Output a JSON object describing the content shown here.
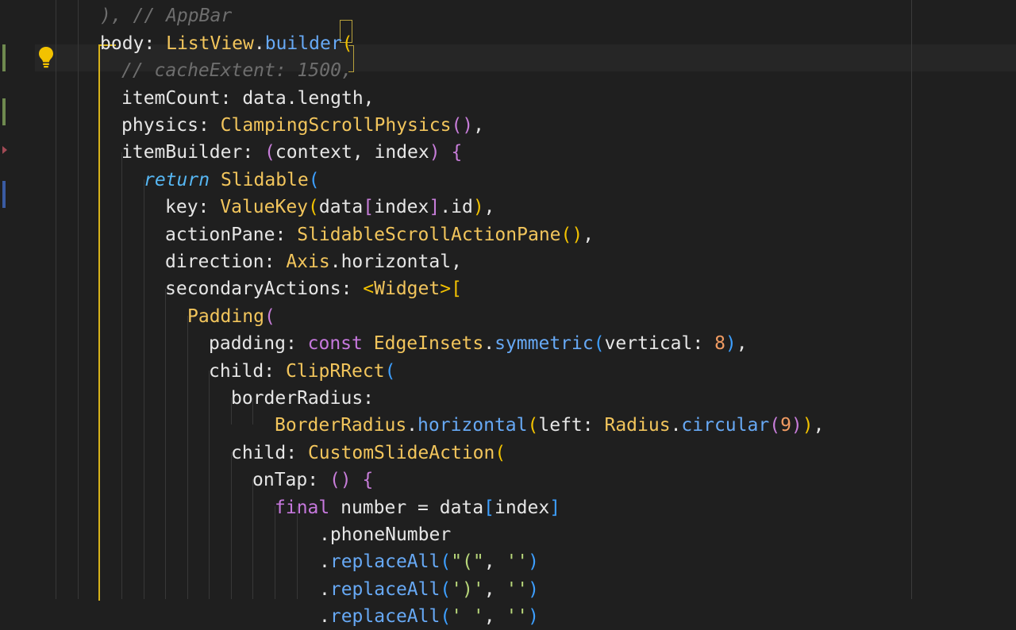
{
  "editor": {
    "lines": [
      [
        {
          "t": "), // AppBar",
          "c": "t-comment"
        }
      ],
      [
        {
          "t": "body",
          "c": "t-default"
        },
        {
          "t": ": ",
          "c": "t-punct"
        },
        {
          "t": "ListView",
          "c": "t-class"
        },
        {
          "t": ".",
          "c": "t-punct"
        },
        {
          "t": "builder",
          "c": "t-method"
        },
        {
          "t": "(",
          "c": "t-paren1"
        }
      ],
      [
        {
          "t": "// cacheExtent: 1500,",
          "c": "t-comment"
        }
      ],
      [
        {
          "t": "itemCount",
          "c": "t-default"
        },
        {
          "t": ": ",
          "c": "t-punct"
        },
        {
          "t": "data",
          "c": "t-default"
        },
        {
          "t": ".",
          "c": "t-punct"
        },
        {
          "t": "length",
          "c": "t-default"
        },
        {
          "t": ",",
          "c": "t-punct"
        }
      ],
      [
        {
          "t": "physics",
          "c": "t-default"
        },
        {
          "t": ": ",
          "c": "t-punct"
        },
        {
          "t": "ClampingScrollPhysics",
          "c": "t-class"
        },
        {
          "t": "()",
          "c": "t-paren2"
        },
        {
          "t": ",",
          "c": "t-punct"
        }
      ],
      [
        {
          "t": "itemBuilder",
          "c": "t-default"
        },
        {
          "t": ": ",
          "c": "t-punct"
        },
        {
          "t": "(",
          "c": "t-paren2"
        },
        {
          "t": "context, index",
          "c": "t-default"
        },
        {
          "t": ")",
          "c": "t-paren2"
        },
        {
          "t": " ",
          "c": "t-punct"
        },
        {
          "t": "{",
          "c": "t-paren2"
        }
      ],
      [
        {
          "t": "return",
          "c": "t-keyword-italic"
        },
        {
          "t": " ",
          "c": "t-punct"
        },
        {
          "t": "Slidable",
          "c": "t-class"
        },
        {
          "t": "(",
          "c": "t-paren3"
        }
      ],
      [
        {
          "t": "key",
          "c": "t-default"
        },
        {
          "t": ": ",
          "c": "t-punct"
        },
        {
          "t": "ValueKey",
          "c": "t-class"
        },
        {
          "t": "(",
          "c": "t-paren1"
        },
        {
          "t": "data",
          "c": "t-default"
        },
        {
          "t": "[",
          "c": "t-paren2"
        },
        {
          "t": "index",
          "c": "t-default"
        },
        {
          "t": "]",
          "c": "t-paren2"
        },
        {
          "t": ".",
          "c": "t-punct"
        },
        {
          "t": "id",
          "c": "t-default"
        },
        {
          "t": ")",
          "c": "t-paren1"
        },
        {
          "t": ",",
          "c": "t-punct"
        }
      ],
      [
        {
          "t": "actionPane",
          "c": "t-default"
        },
        {
          "t": ": ",
          "c": "t-punct"
        },
        {
          "t": "SlidableScrollActionPane",
          "c": "t-class"
        },
        {
          "t": "()",
          "c": "t-paren1"
        },
        {
          "t": ",",
          "c": "t-punct"
        }
      ],
      [
        {
          "t": "direction",
          "c": "t-default"
        },
        {
          "t": ": ",
          "c": "t-punct"
        },
        {
          "t": "Axis",
          "c": "t-class"
        },
        {
          "t": ".",
          "c": "t-punct"
        },
        {
          "t": "horizontal",
          "c": "t-default"
        },
        {
          "t": ",",
          "c": "t-punct"
        }
      ],
      [
        {
          "t": "secondaryActions",
          "c": "t-default"
        },
        {
          "t": ": ",
          "c": "t-punct"
        },
        {
          "t": "<",
          "c": "t-paren1"
        },
        {
          "t": "Widget",
          "c": "t-class"
        },
        {
          "t": ">",
          "c": "t-paren1"
        },
        {
          "t": "[",
          "c": "t-paren1"
        }
      ],
      [
        {
          "t": "Padding",
          "c": "t-class"
        },
        {
          "t": "(",
          "c": "t-paren2"
        }
      ],
      [
        {
          "t": "padding",
          "c": "t-default"
        },
        {
          "t": ": ",
          "c": "t-punct"
        },
        {
          "t": "const",
          "c": "t-keyword"
        },
        {
          "t": " ",
          "c": "t-punct"
        },
        {
          "t": "EdgeInsets",
          "c": "t-class"
        },
        {
          "t": ".",
          "c": "t-punct"
        },
        {
          "t": "symmetric",
          "c": "t-method"
        },
        {
          "t": "(",
          "c": "t-paren3"
        },
        {
          "t": "vertical",
          "c": "t-default"
        },
        {
          "t": ": ",
          "c": "t-punct"
        },
        {
          "t": "8",
          "c": "t-number"
        },
        {
          "t": ")",
          "c": "t-paren3"
        },
        {
          "t": ",",
          "c": "t-punct"
        }
      ],
      [
        {
          "t": "child",
          "c": "t-default"
        },
        {
          "t": ": ",
          "c": "t-punct"
        },
        {
          "t": "ClipRRect",
          "c": "t-class"
        },
        {
          "t": "(",
          "c": "t-paren3"
        }
      ],
      [
        {
          "t": "borderRadius",
          "c": "t-default"
        },
        {
          "t": ":",
          "c": "t-punct"
        }
      ],
      [
        {
          "t": "BorderRadius",
          "c": "t-class"
        },
        {
          "t": ".",
          "c": "t-punct"
        },
        {
          "t": "horizontal",
          "c": "t-method"
        },
        {
          "t": "(",
          "c": "t-paren1"
        },
        {
          "t": "left",
          "c": "t-default"
        },
        {
          "t": ": ",
          "c": "t-punct"
        },
        {
          "t": "Radius",
          "c": "t-class"
        },
        {
          "t": ".",
          "c": "t-punct"
        },
        {
          "t": "circular",
          "c": "t-method"
        },
        {
          "t": "(",
          "c": "t-paren2"
        },
        {
          "t": "9",
          "c": "t-number"
        },
        {
          "t": ")",
          "c": "t-paren2"
        },
        {
          "t": ")",
          "c": "t-paren1"
        },
        {
          "t": ",",
          "c": "t-punct"
        }
      ],
      [
        {
          "t": "child",
          "c": "t-default"
        },
        {
          "t": ": ",
          "c": "t-punct"
        },
        {
          "t": "CustomSlideAction",
          "c": "t-class"
        },
        {
          "t": "(",
          "c": "t-paren1"
        }
      ],
      [
        {
          "t": "onTap",
          "c": "t-default"
        },
        {
          "t": ": ",
          "c": "t-punct"
        },
        {
          "t": "()",
          "c": "t-paren2"
        },
        {
          "t": " ",
          "c": "t-punct"
        },
        {
          "t": "{",
          "c": "t-paren2"
        }
      ],
      [
        {
          "t": "final",
          "c": "t-keyword"
        },
        {
          "t": " number = ",
          "c": "t-default"
        },
        {
          "t": "data",
          "c": "t-default"
        },
        {
          "t": "[",
          "c": "t-paren3"
        },
        {
          "t": "index",
          "c": "t-default"
        },
        {
          "t": "]",
          "c": "t-paren3"
        }
      ],
      [
        {
          "t": ".",
          "c": "t-punct"
        },
        {
          "t": "phoneNumber",
          "c": "t-default"
        }
      ],
      [
        {
          "t": ".",
          "c": "t-punct"
        },
        {
          "t": "replaceAll",
          "c": "t-method"
        },
        {
          "t": "(",
          "c": "t-paren3"
        },
        {
          "t": "\"(\"",
          "c": "t-string"
        },
        {
          "t": ", ",
          "c": "t-punct"
        },
        {
          "t": "''",
          "c": "t-string"
        },
        {
          "t": ")",
          "c": "t-paren3"
        }
      ],
      [
        {
          "t": ".",
          "c": "t-punct"
        },
        {
          "t": "replaceAll",
          "c": "t-method"
        },
        {
          "t": "(",
          "c": "t-paren3"
        },
        {
          "t": "')'",
          "c": "t-string"
        },
        {
          "t": ", ",
          "c": "t-punct"
        },
        {
          "t": "''",
          "c": "t-string"
        },
        {
          "t": ")",
          "c": "t-paren3"
        }
      ],
      [
        {
          "t": ".",
          "c": "t-punct"
        },
        {
          "t": "replaceAll",
          "c": "t-method"
        },
        {
          "t": "(",
          "c": "t-paren3"
        },
        {
          "t": "' '",
          "c": "t-string"
        },
        {
          "t": ", ",
          "c": "t-punct"
        },
        {
          "t": "''",
          "c": "t-string"
        },
        {
          "t": ")",
          "c": "t-paren3"
        }
      ]
    ]
  },
  "icons": {
    "lightbulb": "lightbulb-icon"
  },
  "colors": {
    "background": "#1f1f1f",
    "active_scope": "#d7b21a",
    "bulb": "#f2c200"
  }
}
